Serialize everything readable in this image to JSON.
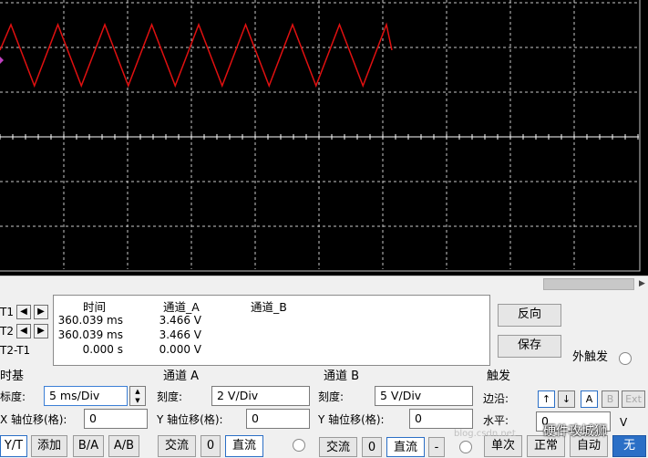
{
  "cursor_labels": {
    "t1": "T1",
    "t2": "T2",
    "t2_t1": "T2-T1"
  },
  "cursor_arrows": {
    "left": "◀",
    "right": "▶"
  },
  "readout": {
    "headers": {
      "time": "时间",
      "channel_a": "通道_A",
      "channel_b": "通道_B"
    },
    "rows": [
      {
        "time": "360.039 ms",
        "channel_a": "3.466 V",
        "channel_b": ""
      },
      {
        "time": "360.039 ms",
        "channel_a": "3.466 V",
        "channel_b": ""
      },
      {
        "time": "0.000 s",
        "channel_a": "0.000 V",
        "channel_b": ""
      }
    ]
  },
  "right_buttons": {
    "reverse": "反向",
    "save": "保存",
    "ext_trigger": "外触发"
  },
  "timebase": {
    "title": "时基",
    "scale_label": "标度:",
    "scale_value": "5 ms/Div",
    "x_offset_label": "X 轴位移(格):",
    "x_offset_value": "0",
    "modes": [
      "Y/T",
      "添加",
      "B/A",
      "A/B"
    ]
  },
  "channel_a": {
    "title": "通道 A",
    "scale_label": "刻度:",
    "scale_value": "2  V/Div",
    "y_offset_label": "Y 轴位移(格):",
    "y_offset_value": "0",
    "coupling": [
      "交流",
      "0",
      "直流"
    ]
  },
  "channel_b": {
    "title": "通道 B",
    "scale_label": "刻度:",
    "scale_value": "5  V/Div",
    "y_offset_label": "Y 轴位移(格):",
    "y_offset_value": "0",
    "coupling": [
      "交流",
      "0",
      "直流",
      "-"
    ]
  },
  "trigger": {
    "title": "触发",
    "edge_label": "边沿:",
    "edge_buttons": [
      "↑",
      "↓",
      "A",
      "B",
      "Ext"
    ],
    "level_label": "水平:",
    "level_value": "0",
    "level_unit": "V",
    "modes": [
      "单次",
      "正常",
      "自动",
      "无"
    ]
  },
  "watermark": {
    "text": "硬件攻城狮",
    "faint": "blog.csdn.net"
  },
  "waveform": {
    "type": "triangle",
    "color": "#e01010",
    "grid_color": "#c8c8c8",
    "background": "#000000"
  }
}
